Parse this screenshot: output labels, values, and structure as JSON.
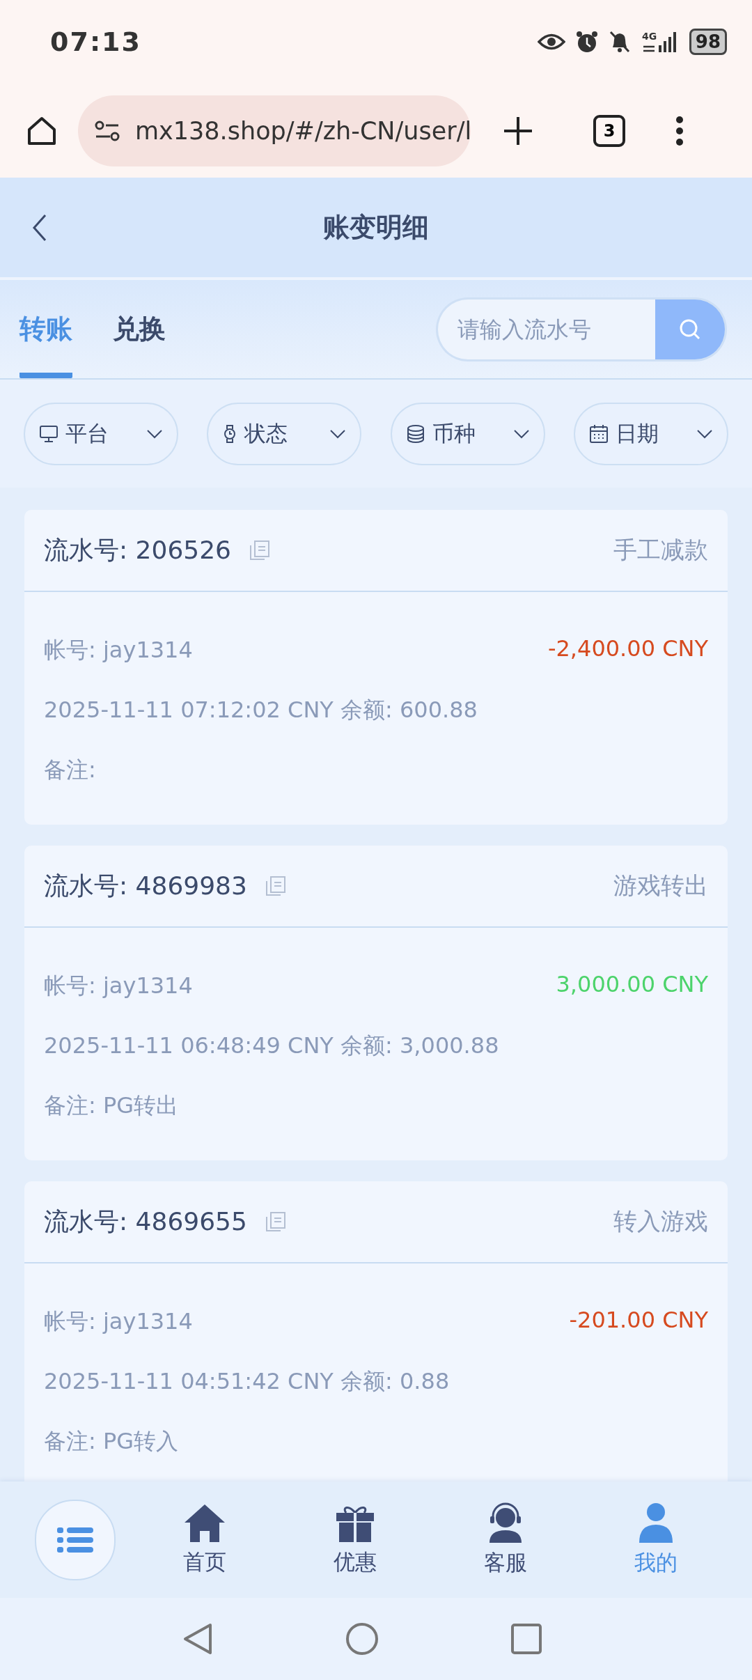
{
  "status_bar": {
    "time": "07:13",
    "network": "4G",
    "battery": "98"
  },
  "browser": {
    "url": "mx138.shop/#/zh-CN/user/l",
    "tab_count": "3"
  },
  "header": {
    "title": "账变明细"
  },
  "tabs": [
    {
      "label": "转账",
      "selected": true
    },
    {
      "label": "兑换",
      "selected": false
    }
  ],
  "search": {
    "placeholder": "请输入流水号"
  },
  "filters": [
    {
      "kind": "platform",
      "label": "平台"
    },
    {
      "kind": "status",
      "label": "状态"
    },
    {
      "kind": "currency",
      "label": "币种"
    },
    {
      "kind": "date",
      "label": "日期"
    }
  ],
  "records": [
    {
      "serial": "流水号: 206526",
      "type": "手工减款",
      "account": "帐号: jay1314",
      "amount": "-2,400.00 CNY",
      "kind": "out",
      "detail": "2025-11-11 07:12:02 CNY 余额: 600.88",
      "note": "备注:"
    },
    {
      "serial": "流水号: 4869983",
      "type": "游戏转出",
      "account": "帐号: jay1314",
      "amount": "3,000.00 CNY",
      "kind": "in",
      "detail": "2025-11-11 06:48:49 CNY 余额: 3,000.88",
      "note": "备注: PG转出"
    },
    {
      "serial": "流水号: 4869655",
      "type": "转入游戏",
      "account": "帐号: jay1314",
      "amount": "-201.00 CNY",
      "kind": "out",
      "detail": "2025-11-11 04:51:42 CNY 余额: 0.88",
      "note": "备注: PG转入"
    }
  ],
  "bottom_nav": [
    {
      "kind": "home",
      "label": "首页",
      "selected": false
    },
    {
      "kind": "gift",
      "label": "优惠",
      "selected": false
    },
    {
      "kind": "support",
      "label": "客服",
      "selected": false
    },
    {
      "kind": "user",
      "label": "我的",
      "selected": true
    }
  ]
}
